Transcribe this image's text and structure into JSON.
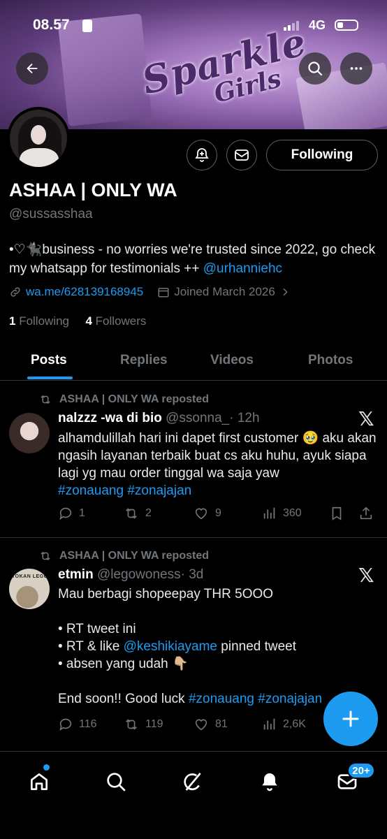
{
  "status_bar": {
    "time": "08.57",
    "network": "4G"
  },
  "profile": {
    "display_name": "ASHAA | ONLY WA",
    "handle": "@sussasshaa",
    "bio_text": "•♡🐈‍⬛business - no worries we're trusted since 2022, go check my whatsapp for testimonials ++ ",
    "bio_mention": "@urhanniehc",
    "website": "wa.me/628139168945",
    "joined": "Joined March 2026",
    "following_count": "1",
    "following_label": " Following",
    "followers_count": "4",
    "followers_label": " Followers",
    "follow_button": "Following"
  },
  "banner": {
    "line1": "Sparkle",
    "line2": "Girls"
  },
  "tabs": [
    {
      "label": "Posts",
      "active": true
    },
    {
      "label": "Replies",
      "active": false
    },
    {
      "label": "Videos",
      "active": false
    },
    {
      "label": "Photos",
      "active": false
    }
  ],
  "posts": [
    {
      "repost_label": "ASHAA | ONLY WA reposted",
      "author_name": "nalzzz -wa di bio",
      "author_handle": "@ssonna_",
      "time": "· 12h",
      "text_main": "alhamdulillah hari ini dapet first customer 🥹 aku akan ngasih layanan terbaik buat cs aku huhu, ayuk siapa lagi yg mau order tinggal wa saja yaw",
      "hashtags": "#zonauang #zonajajan",
      "replies": "1",
      "reposts": "2",
      "likes": "9",
      "views": "360"
    },
    {
      "repost_label": "ASHAA | ONLY WA reposted",
      "author_name": "etmin",
      "author_handle": "@legowoness",
      "time": "· 3d",
      "avatar_caption": "TOKAN LEGO",
      "line1": "Mau berbagi shopeepay THR 5OOO",
      "line2": "• RT tweet ini",
      "line3_pre": "• RT & like ",
      "line3_mention": "@keshikiayame",
      "line3_post": " pinned tweet",
      "line4": "• absen yang udah 👇🏼",
      "line5_pre": "End soon!! Good luck ",
      "line5_tags": "#zonauang #zonajajan",
      "replies": "116",
      "reposts": "119",
      "likes": "81",
      "views": "2,6K"
    }
  ],
  "nav": {
    "badge": "20+"
  },
  "colors": {
    "accent": "#1d9bf0",
    "background": "#000000",
    "muted": "#71767b",
    "border": "#2f3336"
  }
}
